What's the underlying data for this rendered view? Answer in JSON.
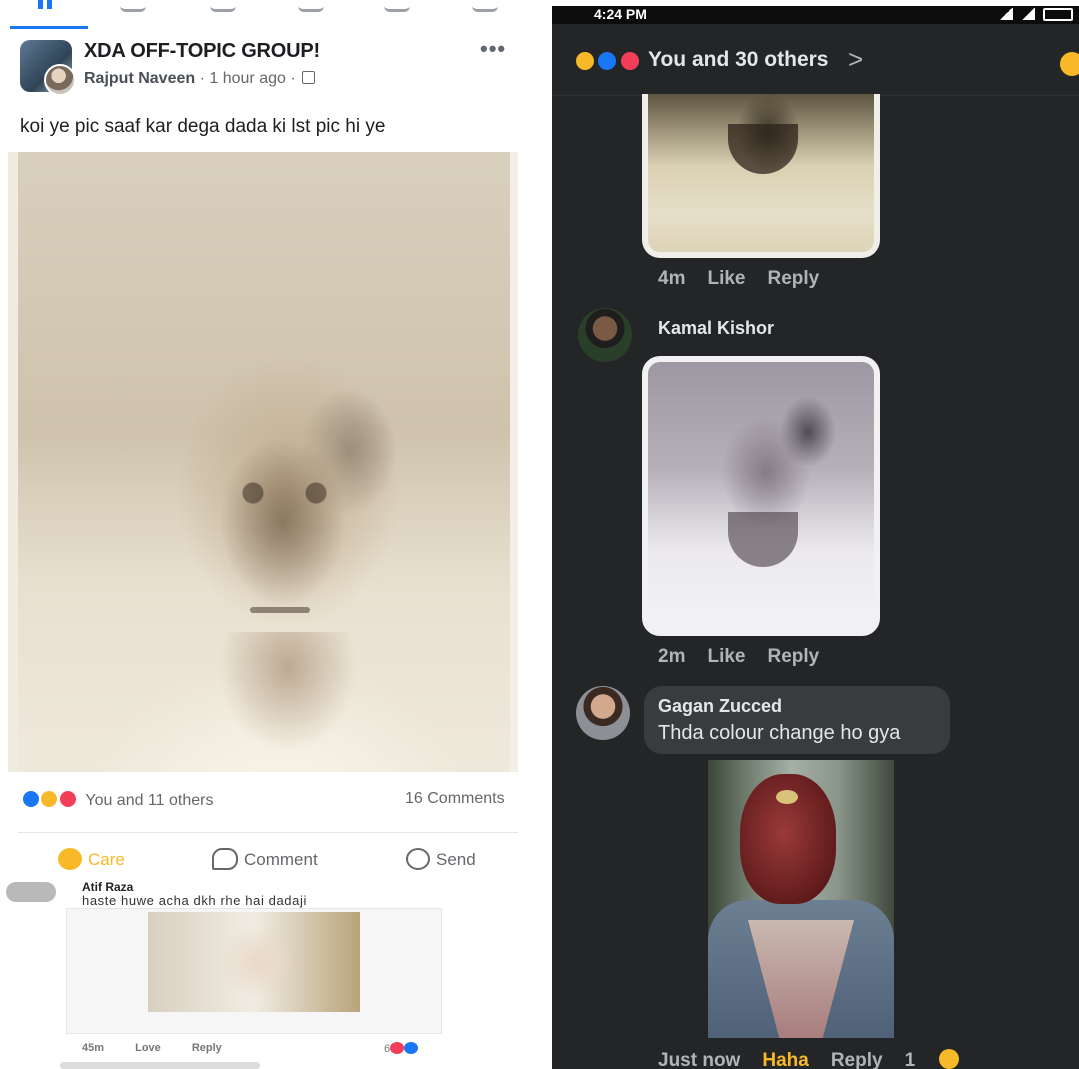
{
  "left": {
    "post": {
      "group_name": "XDA OFF-TOPIC GROUP!",
      "author": "Rajput Naveen",
      "time": "1 hour ago",
      "more": "•••",
      "text": "koi ye pic saaf kar dega dada ki lst pic hi ye"
    },
    "reactions": {
      "summary": "You and 11 others",
      "comments": "16 Comments"
    },
    "actions": {
      "care": "Care",
      "comment": "Comment",
      "send": "Send"
    },
    "comment": {
      "name": "Atif Raza",
      "text": "haste huwe acha dkh rhe hai dadaji",
      "time": "45m",
      "love": "Love",
      "reply": "Reply",
      "reaction_count": "6"
    }
  },
  "right": {
    "status": {
      "time": "4:24 PM"
    },
    "reactions_header": {
      "summary": "You and 30 others",
      "chevron": ">"
    },
    "comment1": {
      "time": "4m",
      "like": "Like",
      "reply": "Reply"
    },
    "comment2": {
      "name": "Kamal Kishor",
      "time": "2m",
      "like": "Like",
      "reply": "Reply"
    },
    "comment3": {
      "name": "Gagan Zucced",
      "text": "Thda colour change ho gya",
      "time": "Just now",
      "haha": "Haha",
      "reply": "Reply",
      "reaction_count": "1"
    }
  },
  "colors": {
    "facebook_blue": "#1877f2",
    "care_yellow": "#f7b928",
    "love_red": "#f33e58",
    "dark_bg": "#242526"
  }
}
